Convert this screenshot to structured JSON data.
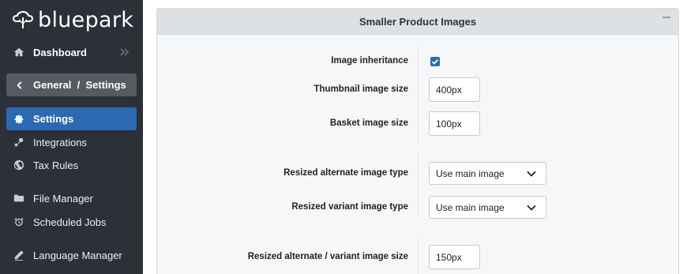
{
  "brand": {
    "name": "bluepark"
  },
  "sidebar": {
    "dashboard": {
      "label": "Dashboard",
      "icon": "home-icon"
    },
    "breadcrumb": {
      "label": "General  /  Settings",
      "icon": "chevron-left-icon"
    },
    "items": [
      {
        "label": "Settings",
        "icon": "gear-icon",
        "active": true
      },
      {
        "label": "Integrations",
        "icon": "plug-icon"
      },
      {
        "label": "Tax Rules",
        "icon": "globe-icon"
      },
      {
        "label": "File Manager",
        "icon": "folder-icon"
      },
      {
        "label": "Scheduled Jobs",
        "icon": "alarm-clock-icon"
      },
      {
        "label": "Language Manager",
        "icon": "pen-icon"
      }
    ]
  },
  "panel": {
    "title": "Smaller Product Images",
    "fields": {
      "image_inheritance": {
        "label": "Image inheritance",
        "checked": true
      },
      "thumbnail_size": {
        "label": "Thumbnail image size",
        "value": "400px"
      },
      "basket_size": {
        "label": "Basket image size",
        "value": "100px"
      },
      "alt_type": {
        "label": "Resized alternate image type",
        "value": "Use main image"
      },
      "variant_type": {
        "label": "Resized variant image type",
        "value": "Use main image"
      },
      "alt_variant_size": {
        "label": "Resized alternate / variant image size",
        "value": "150px"
      }
    }
  },
  "colors": {
    "sidebar_bg": "#2b3039",
    "accent": "#2b6ab2",
    "crumb_bg": "#565b62",
    "panel_header": "#dde1e4"
  }
}
